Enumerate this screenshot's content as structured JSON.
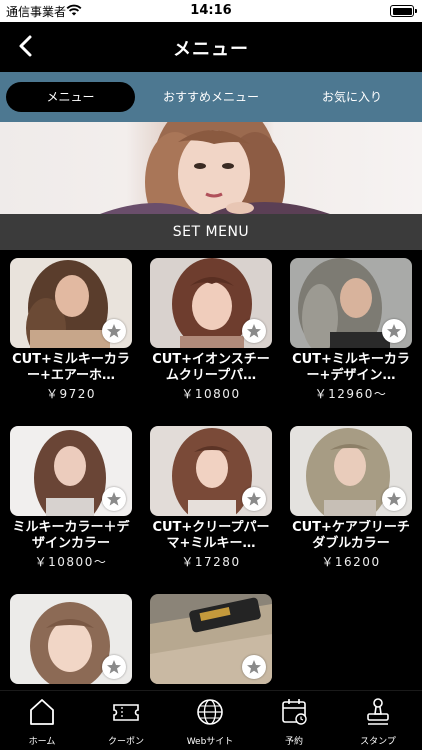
{
  "status_bar": {
    "carrier": "通信事業者",
    "time": "14:16"
  },
  "nav": {
    "title": "メニュー"
  },
  "tabs": [
    {
      "label": "メニュー",
      "active": true
    },
    {
      "label": "おすすめメニュー",
      "active": false
    },
    {
      "label": "お気に入り",
      "active": false
    }
  ],
  "section": {
    "title": "SET MENU"
  },
  "menu_items": [
    {
      "name": "CUT+ミルキーカラー+エアーホ…",
      "price": "￥9720"
    },
    {
      "name": "CUT+イオンスチームクリープパ…",
      "price": "￥10800"
    },
    {
      "name": "CUT+ミルキーカラー+デザイン…",
      "price": "￥12960〜"
    },
    {
      "name": "ミルキーカラー＋デザインカラー",
      "price": "￥10800〜"
    },
    {
      "name": "CUT+クリープパーマ+ミルキー…",
      "price": "￥17280"
    },
    {
      "name": "CUT+ケアブリーチダブルカラー",
      "price": "￥16200"
    },
    {
      "name": "",
      "price": ""
    },
    {
      "name": "",
      "price": ""
    }
  ],
  "tab_bar": [
    {
      "label": "ホーム",
      "icon": "home-icon"
    },
    {
      "label": "クーポン",
      "icon": "coupon-icon"
    },
    {
      "label": "Webサイト",
      "icon": "globe-icon"
    },
    {
      "label": "予約",
      "icon": "calendar-icon"
    },
    {
      "label": "スタンプ",
      "icon": "stamp-icon"
    }
  ],
  "colors": {
    "tab_band": "#4d7891",
    "section_band": "#3b3b3b",
    "background": "#000000"
  }
}
